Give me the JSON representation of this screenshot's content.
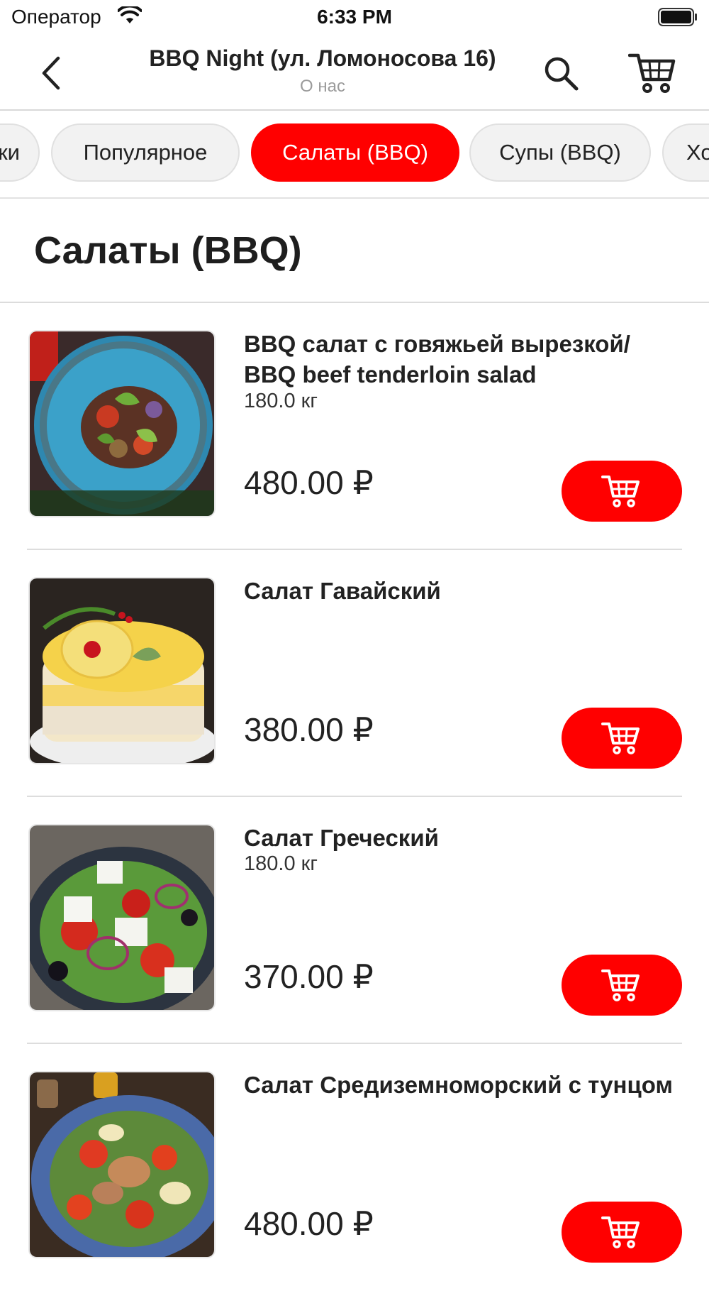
{
  "status_bar": {
    "carrier": "Оператор",
    "time": "6:33 PM"
  },
  "nav": {
    "title": "BBQ Night (ул. Ломоносова 16)",
    "subtitle": "О нас"
  },
  "categories": [
    {
      "label": "Напитки",
      "active": false
    },
    {
      "label": "Популярное",
      "active": false
    },
    {
      "label": "Салаты (BBQ)",
      "active": true
    },
    {
      "label": "Супы (BBQ)",
      "active": false
    },
    {
      "label": "Холодные закуски",
      "active": false
    }
  ],
  "section": {
    "title": "Салаты (BBQ)"
  },
  "products": [
    {
      "name": "BBQ салат с говяжьей вырезкой/ BBQ beef tenderloin salad",
      "weight": "180.0 кг",
      "price": "480.00 ₽",
      "icon": "salad-beef-photo"
    },
    {
      "name": "Салат Гавайский",
      "weight": "",
      "price": "380.00 ₽",
      "icon": "salad-hawaiian-photo"
    },
    {
      "name": "Салат Греческий",
      "weight": "180.0 кг",
      "price": "370.00 ₽",
      "icon": "salad-greek-photo"
    },
    {
      "name": "Салат Средиземноморский с тунцом",
      "weight": "",
      "price": "480.00 ₽",
      "icon": "salad-tuna-photo"
    }
  ],
  "colors": {
    "accent": "#ff0000",
    "chip_bg": "#f2f2f2",
    "divider": "#dddddd"
  },
  "icons": {
    "back": "chevron-left-icon",
    "search": "search-icon",
    "cart": "cart-icon",
    "add_to_cart": "cart-icon"
  }
}
